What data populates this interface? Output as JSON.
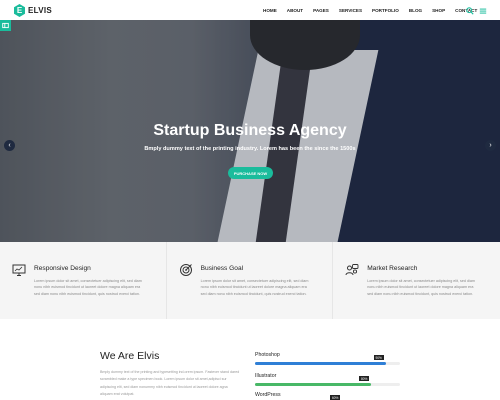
{
  "brand": {
    "letter": "E",
    "name": "ELVIS",
    "accent": "#1abc9c"
  },
  "nav": {
    "items": [
      "HOME",
      "ABOUT",
      "PAGES",
      "SERVICES",
      "PORTFOLIO",
      "BLOG",
      "SHOP",
      "CONTACT"
    ]
  },
  "header_icons": [
    "search-icon",
    "menu-icon"
  ],
  "hero": {
    "title": "Startup Business Agency",
    "subtitle": "Bmply dummy text of the printing industry. Lorem has been the since the 1500s",
    "button": "PURCHASE NOW"
  },
  "services": [
    {
      "icon": "monitor-icon",
      "title": "Responsive Design",
      "text": "Lorem ipsum dolor sit amet, consectetuer adipiscing elit, sed diam nonu nibh euismod tincidunt ut laoreet dolore magna aliquam era sed diam nonu nibh euismod tincidunt, quis nostrud exerci tation."
    },
    {
      "icon": "target-icon",
      "title": "Business Goal",
      "text": "Lorem ipsum dolor sit amet, consectetuer adipiscing elit, sed diam nonu nibh euismod tincidunt ut laoreet dolore magna aliquam era sed diam nonu nibh euismod tincidunt, quis nostrud exerci tation."
    },
    {
      "icon": "chat-users-icon",
      "title": "Market Research",
      "text": "Lorem ipsum dolor sit amet, consectetuer adipiscing elit, sed diam nonu nibh euismod tincidunt ut laoreet dolore magna aliquam era sed diam nonu nibh euismod tincidunt, quis nostrud exerci tation."
    }
  ],
  "about": {
    "title": "We Are Elvis",
    "text": "Bmply dummy text of the printing and typesetting ind.orem ipsum. Fastever stand dared scrambled make a type specimen book. Lorem ipsum dolor sit amet,adipisci sur adipiscing elit, sed diam nonummy nibh euismod tincidunt ut laoreet dolore agna aliquam erat volutpat."
  },
  "skills": [
    {
      "label": "Photoshop",
      "percent": "90%",
      "value": 0.9,
      "color": "#2f7fd6"
    },
    {
      "label": "Illustrator",
      "percent": "80%",
      "value": 0.8,
      "color": "#48b867"
    },
    {
      "label": "WordPress",
      "percent": "60%",
      "value": 0.6,
      "color": "#2f7fd6"
    }
  ]
}
